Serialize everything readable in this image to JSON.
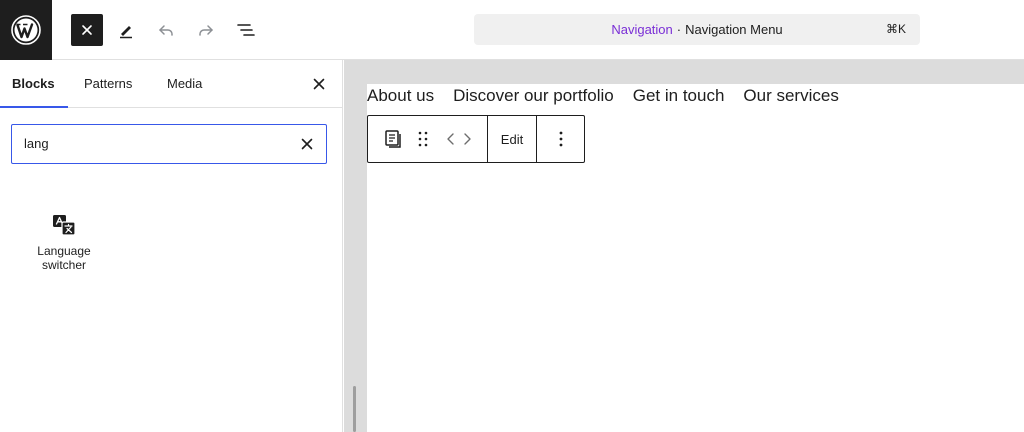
{
  "topbar": {
    "command_bar": {
      "context": "Navigation",
      "separator": "·",
      "title": "Navigation Menu",
      "shortcut": "⌘K"
    }
  },
  "inserter": {
    "tabs": [
      {
        "label": "Blocks",
        "active": true
      },
      {
        "label": "Patterns",
        "active": false
      },
      {
        "label": "Media",
        "active": false
      }
    ],
    "search": {
      "value": "lang"
    },
    "results": [
      {
        "label_line1": "Language",
        "label_line2": "switcher",
        "icon": "translate-icon"
      }
    ]
  },
  "canvas": {
    "nav_items": [
      "About us",
      "Discover our portfolio",
      "Get in touch",
      "Our services"
    ],
    "block_toolbar": {
      "edit_label": "Edit"
    }
  },
  "colors": {
    "accent": "#3858e9",
    "command_context": "#7a2fd6",
    "dark": "#1e1e1e"
  }
}
